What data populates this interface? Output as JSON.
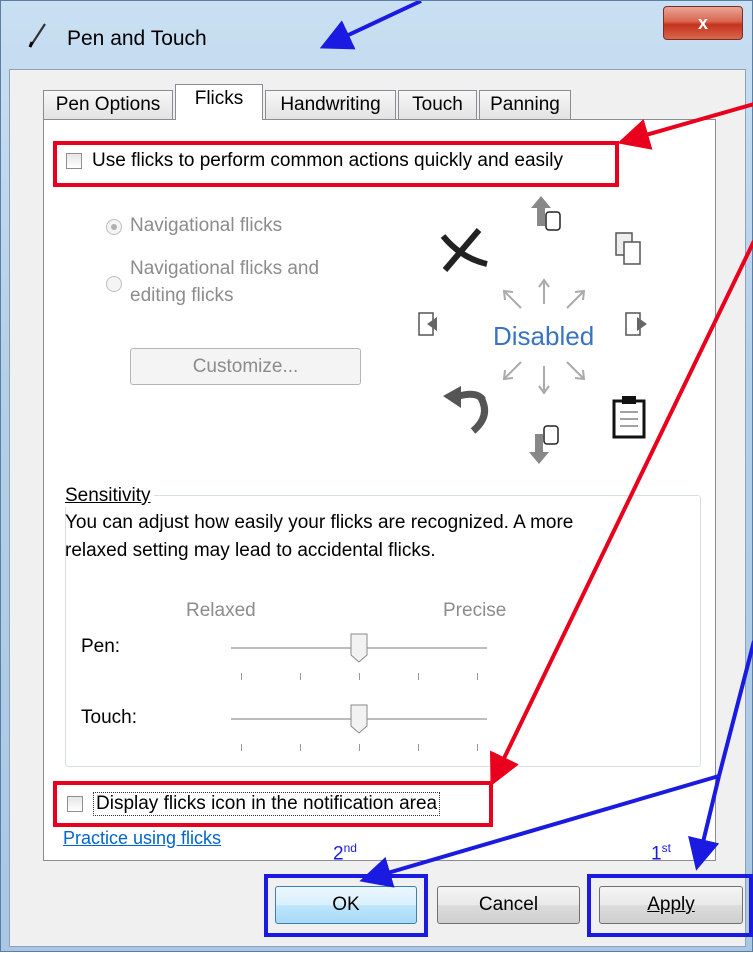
{
  "window": {
    "title": "Pen and Touch",
    "close_label": "x"
  },
  "tabs": [
    {
      "label": "Pen Options",
      "active": false
    },
    {
      "label": "Flicks",
      "active": true
    },
    {
      "label": "Handwriting",
      "active": false
    },
    {
      "label": "Touch",
      "active": false
    },
    {
      "label": "Panning",
      "active": false
    }
  ],
  "flicks": {
    "use_flicks_label": "Use flicks to perform common actions quickly and easily",
    "use_flicks_checked": false,
    "nav_flicks_label": "Navigational flicks",
    "nav_edit_line1": "Navigational flicks and",
    "nav_edit_line2": "editing flicks",
    "customize_label": "Customize...",
    "disabled_label": "Disabled"
  },
  "sensitivity": {
    "legend": "Sensitivity",
    "description_line1": "You can adjust how easily your flicks are recognized. A more",
    "description_line2": "relaxed setting may lead to accidental flicks.",
    "relaxed_label": "Relaxed",
    "precise_label": "Precise",
    "pen_label": "Pen:",
    "touch_label": "Touch:",
    "pen_level": 0.5,
    "touch_level": 0.5
  },
  "footer": {
    "display_icon_label": "Display flicks icon in the notification area",
    "display_icon_checked": false,
    "practice_link": "Practice using flicks",
    "ok_label": "OK",
    "cancel_label": "Cancel",
    "apply_label": "Apply"
  },
  "annotations": {
    "first_label": "1",
    "first_suffix": "st",
    "second_label": "2",
    "second_suffix": "nd",
    "red_color": "#e8001c",
    "blue_color": "#1a1ae0"
  }
}
